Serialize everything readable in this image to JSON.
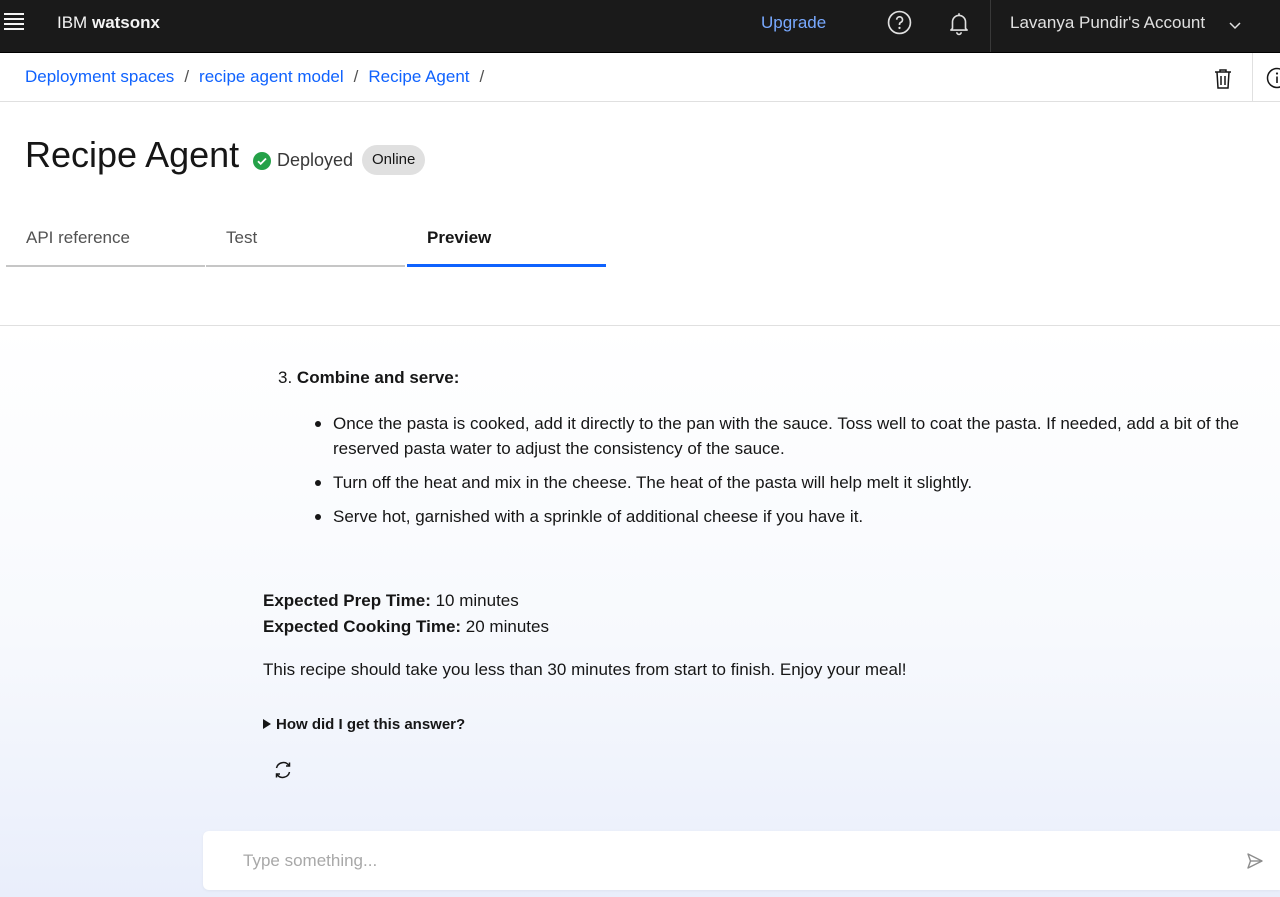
{
  "header": {
    "brand_prefix": "IBM",
    "brand_name": "watsonx",
    "upgrade_label": "Upgrade",
    "account_label": "Lavanya Pundir's Account"
  },
  "breadcrumb": {
    "items": [
      "Deployment spaces",
      "recipe agent model",
      "Recipe Agent"
    ],
    "separator": "/"
  },
  "page": {
    "title": "Recipe Agent",
    "status": "Deployed",
    "tag": "Online"
  },
  "tabs": [
    {
      "label": "API reference",
      "active": false
    },
    {
      "label": "Test",
      "active": false
    },
    {
      "label": "Preview",
      "active": true
    }
  ],
  "chat": {
    "step": {
      "number": "3.",
      "heading": "Combine and serve:",
      "bullets": [
        "Once the pasta is cooked, add it directly to the pan with the sauce. Toss well to coat the pasta. If needed, add a bit of the reserved pasta water to adjust the consistency of the sauce.",
        "Turn off the heat and mix in the cheese. The heat of the pasta will help melt it slightly.",
        "Serve hot, garnished with a sprinkle of additional cheese if you have it."
      ]
    },
    "prep_label": "Expected Prep Time:",
    "prep_value": "10 minutes",
    "cook_label": "Expected Cooking Time:",
    "cook_value": "20 minutes",
    "closing": "This recipe should take you less than 30 minutes from start to finish. Enjoy your meal!",
    "explain_toggle": "How did I get this answer?"
  },
  "input": {
    "placeholder": "Type something..."
  },
  "colors": {
    "accent": "#0f62fe",
    "header_bg": "#1a1a1a",
    "upgrade_link": "#78a9ff",
    "status_green": "#24a148"
  }
}
